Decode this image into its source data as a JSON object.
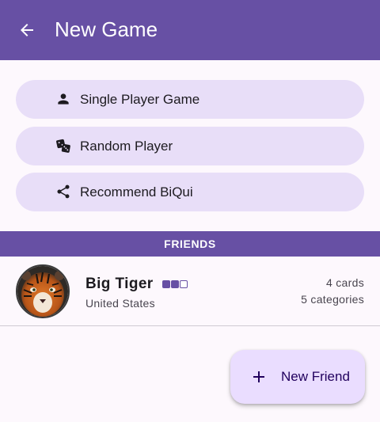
{
  "app_bar": {
    "title": "New Game",
    "back_icon": "arrow-back-icon",
    "background": "#6750a4"
  },
  "options": [
    {
      "label": "Single Player Game",
      "icon": "person-icon"
    },
    {
      "label": "Random Player",
      "icon": "dice-icon"
    },
    {
      "label": "Recommend BiQui",
      "icon": "share-icon"
    }
  ],
  "friends_section": {
    "header": "FRIENDS",
    "friends": [
      {
        "name": "Big Tiger",
        "country": "United States",
        "cards": "4 cards",
        "categories": "5 categories",
        "level": {
          "filled": 2,
          "total": 3
        },
        "avatar": "tiger-photo"
      }
    ]
  },
  "fab": {
    "label": "New Friend",
    "icon": "plus-icon"
  },
  "colors": {
    "primary": "#6750a4",
    "pill": "#e8def8",
    "fab": "#eaddff",
    "surface": "#fdf8fd"
  }
}
